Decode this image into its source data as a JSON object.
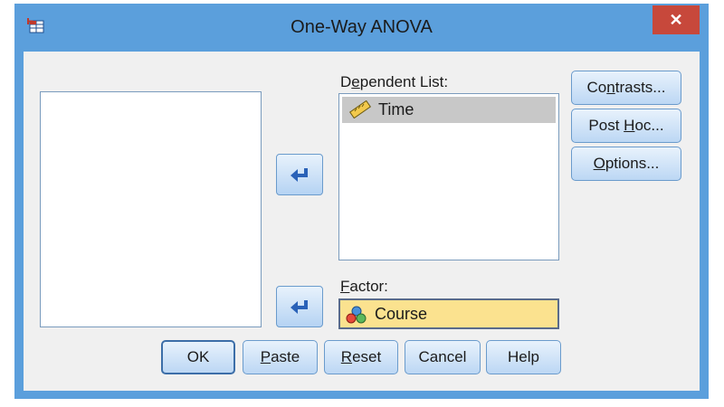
{
  "window": {
    "title": "One-Way ANOVA",
    "close_label": "✕"
  },
  "dependent_list": {
    "label_pre": "D",
    "label_accel": "e",
    "label_post": "pendent List:",
    "items": [
      {
        "label": "Time",
        "icon": "ruler-icon"
      }
    ]
  },
  "factor": {
    "label_accel": "F",
    "label_post": "actor:",
    "value": "Course",
    "icon": "nominal-variable-icon"
  },
  "side_buttons": {
    "contrasts": {
      "pre": "Co",
      "accel": "n",
      "post": "trasts..."
    },
    "post_hoc": {
      "pre": "Post ",
      "accel": "H",
      "post": "oc..."
    },
    "options": {
      "pre": "",
      "accel": "O",
      "post": "ptions..."
    }
  },
  "bottom_buttons": {
    "ok": "OK",
    "paste": {
      "accel": "P",
      "post": "aste"
    },
    "reset": {
      "accel": "R",
      "post": "eset"
    },
    "cancel": "Cancel",
    "help": "Help"
  },
  "colors": {
    "frame": "#5b9fdc",
    "close": "#c7483b",
    "selection": "#c8c8c8",
    "factor_highlight": "#fbe28f"
  }
}
